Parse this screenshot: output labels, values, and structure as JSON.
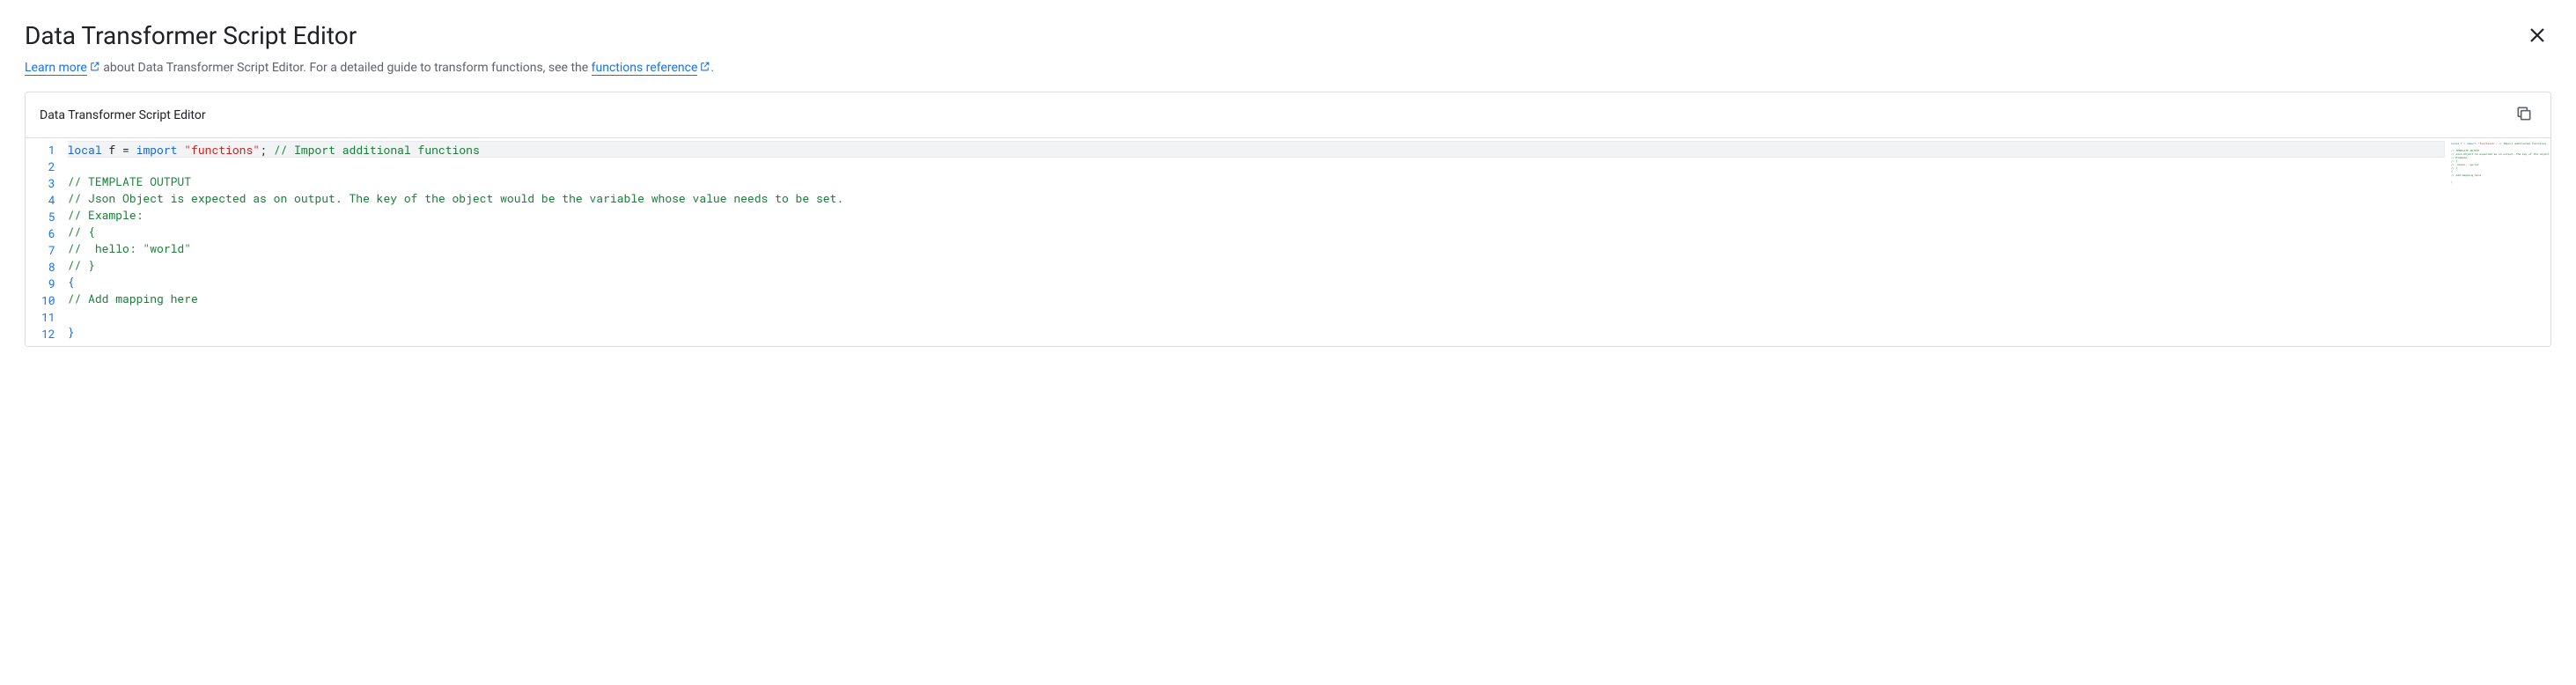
{
  "header": {
    "title": "Data Transformer Script Editor",
    "subtitle_prefix": "Learn more",
    "subtitle_mid": " about Data Transformer Script Editor. For a detailed guide to transform functions, see the ",
    "subtitle_link2": "functions reference",
    "subtitle_suffix": "."
  },
  "editor": {
    "panel_title": "Data Transformer Script Editor",
    "lines": [
      [
        {
          "kind": "keyword",
          "text": "local"
        },
        {
          "kind": "default",
          "text": " f = "
        },
        {
          "kind": "keyword",
          "text": "import"
        },
        {
          "kind": "default",
          "text": " "
        },
        {
          "kind": "string",
          "text": "\"functions\""
        },
        {
          "kind": "default",
          "text": "; "
        },
        {
          "kind": "comment",
          "text": "// Import additional functions"
        }
      ],
      [],
      [
        {
          "kind": "comment",
          "text": "// TEMPLATE OUTPUT"
        }
      ],
      [
        {
          "kind": "comment",
          "text": "// Json Object is expected as on output. The key of the object would be the variable whose value needs to be set."
        }
      ],
      [
        {
          "kind": "comment",
          "text": "// Example:"
        }
      ],
      [
        {
          "kind": "comment",
          "text": "// {"
        }
      ],
      [
        {
          "kind": "comment",
          "text": "//  hello: \"world\""
        }
      ],
      [
        {
          "kind": "comment",
          "text": "// }"
        }
      ],
      [
        {
          "kind": "brace",
          "text": "{"
        }
      ],
      [
        {
          "kind": "comment",
          "text": "// Add mapping here"
        }
      ],
      [],
      [
        {
          "kind": "brace",
          "text": "}"
        }
      ]
    ],
    "current_line": 1
  }
}
